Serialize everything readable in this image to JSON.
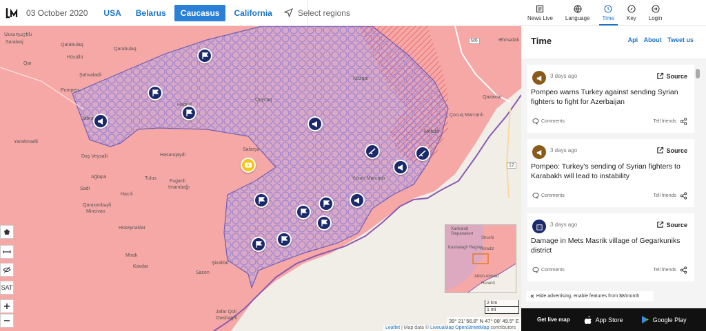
{
  "header": {
    "date": "03 October 2020",
    "regions": [
      {
        "label": "USA",
        "active": false
      },
      {
        "label": "Belarus",
        "active": false
      },
      {
        "label": "Caucasus",
        "active": true
      },
      {
        "label": "California",
        "active": false
      }
    ],
    "select_regions": "Select regions"
  },
  "nav": {
    "items": [
      {
        "label": "News Live",
        "icon": "news-icon"
      },
      {
        "label": "Language",
        "icon": "globe-icon"
      },
      {
        "label": "Time",
        "icon": "clock-icon",
        "active": true
      },
      {
        "label": "Key",
        "icon": "compass-icon"
      },
      {
        "label": "Login",
        "icon": "login-icon"
      }
    ]
  },
  "panel": {
    "title": "Time",
    "links": [
      "Api",
      "About",
      "Tweet us"
    ],
    "cards": [
      {
        "time": "3 days ago",
        "source": "Source",
        "text": "Pompeo warns Turkey against sending Syrian fighters to fight for Azerbaijan",
        "comments": "Comments",
        "tell": "Tell friends",
        "icon": "megaphone-icon",
        "icon_color": "#8a5a1a"
      },
      {
        "time": "3 days ago",
        "source": "Source",
        "text": "Pompeo: Turkey's sending of Syrian fighters to Karabakh will lead to instability",
        "comments": "Comments",
        "tell": "Tell friends",
        "icon": "megaphone-icon",
        "icon_color": "#8a5a1a"
      },
      {
        "time": "3 days ago",
        "source": "Source",
        "text": "Damage in Mets Masrik village of Gegarkuniks district",
        "comments": "Comments",
        "tell": "Tell friends",
        "icon": "building-icon",
        "icon_color": "#1b2a6b"
      }
    ],
    "ad_text": "Hide advertising, enable features from $8/month"
  },
  "appbar": {
    "text": "Get live map",
    "app_store": "App Store",
    "google_play": "Google Play"
  },
  "map": {
    "labels": [
      {
        "text": "Ասաղաշեն"
      },
      {
        "text": "Saralanj"
      },
      {
        "text": "Qarabulaq"
      },
      {
        "text": "Qarabulaq"
      },
      {
        "text": "Hüsüllü"
      },
      {
        "text": "Qar"
      },
      {
        "text": "Şahvaladli"
      },
      {
        "text": "Pompeo"
      },
      {
        "text": "Nüzgar"
      },
      {
        "text": "Quycaq"
      },
      {
        "text": "Jabrayil"
      },
      {
        "text": "Hadrut"
      },
      {
        "text": "Yarahmadli"
      },
      {
        "text": "Daş Veysalli"
      },
      {
        "text": "Hasanqaydi"
      },
      {
        "text": "Safarşa"
      },
      {
        "text": "Ağtapa"
      },
      {
        "text": "Tulus"
      },
      {
        "text": "Fuganli"
      },
      {
        "text": "Imambağı"
      },
      {
        "text": "Sadi"
      },
      {
        "text": "Hacılı"
      },
      {
        "text": "Qaraxanbəyli"
      },
      {
        "text": "Mincivan"
      },
      {
        "text": "Hüseynalılar"
      },
      {
        "text": "Mirak"
      },
      {
        "text": "Kavdar"
      },
      {
        "text": "Şixalılar"
      },
      {
        "text": "Sacen"
      },
      {
        "text": "Jafar Qoli"
      },
      {
        "text": "Owshaghi"
      },
      {
        "text": "Yuxarı Marcanlı"
      },
      {
        "text": "Mehdili"
      },
      {
        "text": "Çocuq Marcanlı"
      },
      {
        "text": "Qazaxlar"
      },
      {
        "text": "Əhmədalı"
      },
      {
        "text": "M6"
      },
      {
        "text": "12"
      }
    ],
    "minimap_labels": [
      "Xankandi",
      "Stepanakert",
      "Shushi",
      "Kashatagh Region",
      "Horadiz",
      "Abish Ahmad",
      "Hurand"
    ],
    "scale": [
      "2 km",
      "1 mi"
    ],
    "coords": "39° 21' 56.8\" N 47° 08' 49.5\" E",
    "attribution_leaflet": "Leaflet",
    "attribution_rest": " | Map data © ",
    "attribution_link": "LiveuaMap OpenStreetMap",
    "attribution_end": " contributors",
    "controls": [
      "SAT"
    ]
  },
  "colors": {
    "accent": "#2a7fd6",
    "marker": "#1b2a6b",
    "armenia_area": "#f4a6a4",
    "azerbaijan_area": "#b8a0e0"
  }
}
